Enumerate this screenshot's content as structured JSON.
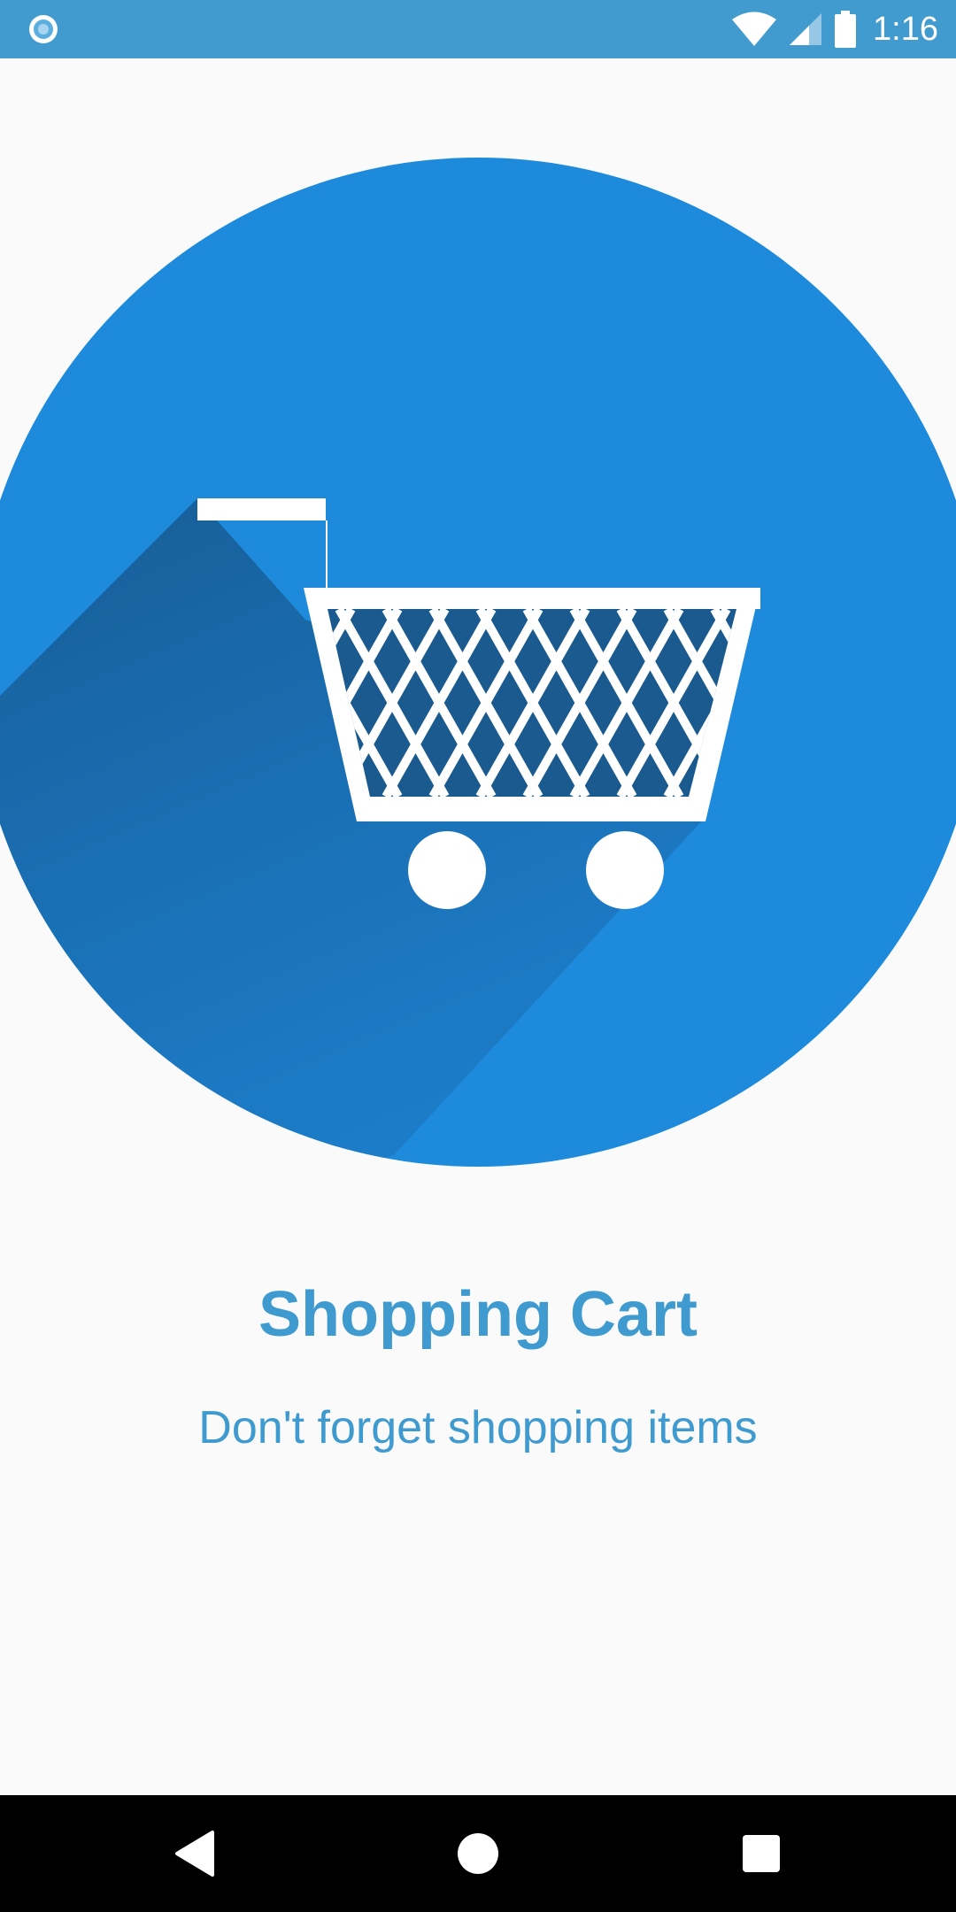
{
  "status_bar": {
    "time": "1:16",
    "left_icon": "notification-dot-icon",
    "right_icons": [
      "wifi-icon",
      "cellular-signal-icon",
      "battery-icon"
    ],
    "background_color": "#419bcf"
  },
  "onboarding": {
    "illustration": "shopping-cart-icon",
    "circle_color": "#1e8adc",
    "title": "Shopping Cart",
    "subtitle": "Don't forget shopping items",
    "text_color": "#3f9ad0"
  },
  "nav_bar": {
    "back_icon": "back-triangle-icon",
    "home_icon": "home-circle-icon",
    "recents_icon": "recents-square-icon"
  }
}
